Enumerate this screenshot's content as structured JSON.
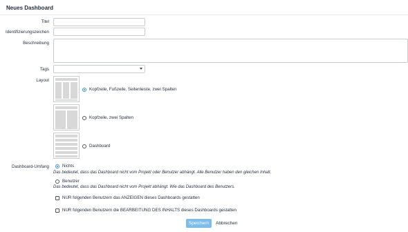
{
  "dialog": {
    "title": "Neues Dashboard"
  },
  "form": {
    "title_label": "Titel",
    "identifier_label": "Identifizierungszeichen",
    "description_label": "Beschreibung",
    "tags_label": "Tags",
    "layout_label": "Layout",
    "layouts": [
      {
        "label": "Kopfzeile, Fußzeile, Seitenleiste, zwei Spalten",
        "selected": true
      },
      {
        "label": "Kopfzeile, zwei Spalten",
        "selected": false
      },
      {
        "label": "Dashboard",
        "selected": false
      }
    ],
    "scope_label": "Dashboard-Umfang",
    "scopes": [
      {
        "label": "Nichts",
        "hint": "Das bedeutet, dass das Dashboard nicht vom Projekt oder Benutzer abhängt. Alle Benutzer haben den gleichen Inhalt.",
        "selected": true
      },
      {
        "label": "Benutzer",
        "hint": "Das bedeutet, dass das Dashboard nicht vom Projekt abhängt. Wie das Dashboard des Benutzers.",
        "selected": false
      }
    ],
    "permissions": [
      {
        "label": "NUR folgenden Benutzern das ANZEIGEN dieses Dashboards gestatten",
        "checked": false
      },
      {
        "label": "NUR folgenden Benutzern die BEARBEITUNG DES INHALTS dieses Dashboards gestatten",
        "checked": false
      }
    ]
  },
  "actions": {
    "save_label": "Speichern",
    "cancel_label": "Abbrechen"
  },
  "colors": {
    "accent": "#3b8fd6",
    "save_button": "#7cbde9"
  }
}
